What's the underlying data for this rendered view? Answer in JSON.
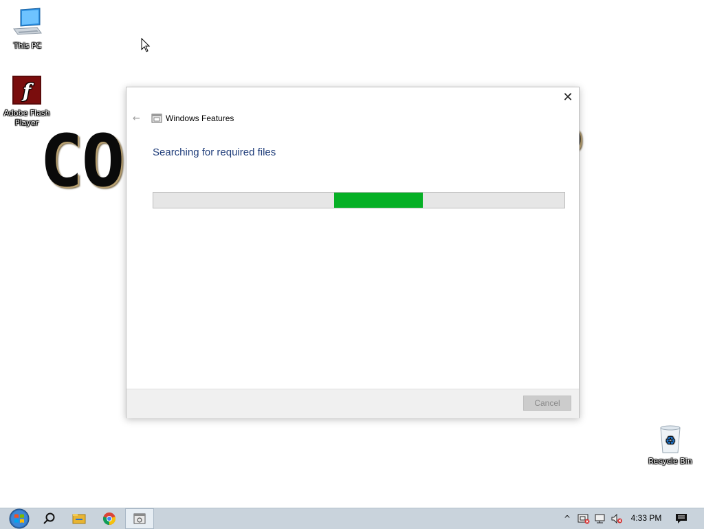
{
  "desktop": {
    "wallpaper_left": "CO",
    "wallpaper_right": "O",
    "icons": [
      {
        "label": "This PC"
      },
      {
        "label": "Adobe Flash Player"
      },
      {
        "label": "Recycle Bin"
      }
    ]
  },
  "dialog": {
    "title": "Windows Features",
    "heading": "Searching for required files",
    "progress": {
      "fill_start": 0.44,
      "fill_end": 0.655,
      "fill_color": "#06b025"
    },
    "close_glyph": "✕",
    "back_glyph": "←",
    "cancel_label": "Cancel"
  },
  "taskbar": {
    "items": [
      {
        "icon": "windows-start-icon"
      },
      {
        "icon": "search-icon"
      },
      {
        "icon": "file-explorer-icon"
      },
      {
        "icon": "chrome-icon"
      },
      {
        "icon": "windows-features-icon",
        "active": true
      }
    ],
    "tray": {
      "chevron": "^",
      "clock": "4:33 PM"
    }
  },
  "colors": {
    "heading_text": "#1f3d7a",
    "taskbar_bg": "#c9d3dc",
    "progress_fill": "#06b025"
  }
}
